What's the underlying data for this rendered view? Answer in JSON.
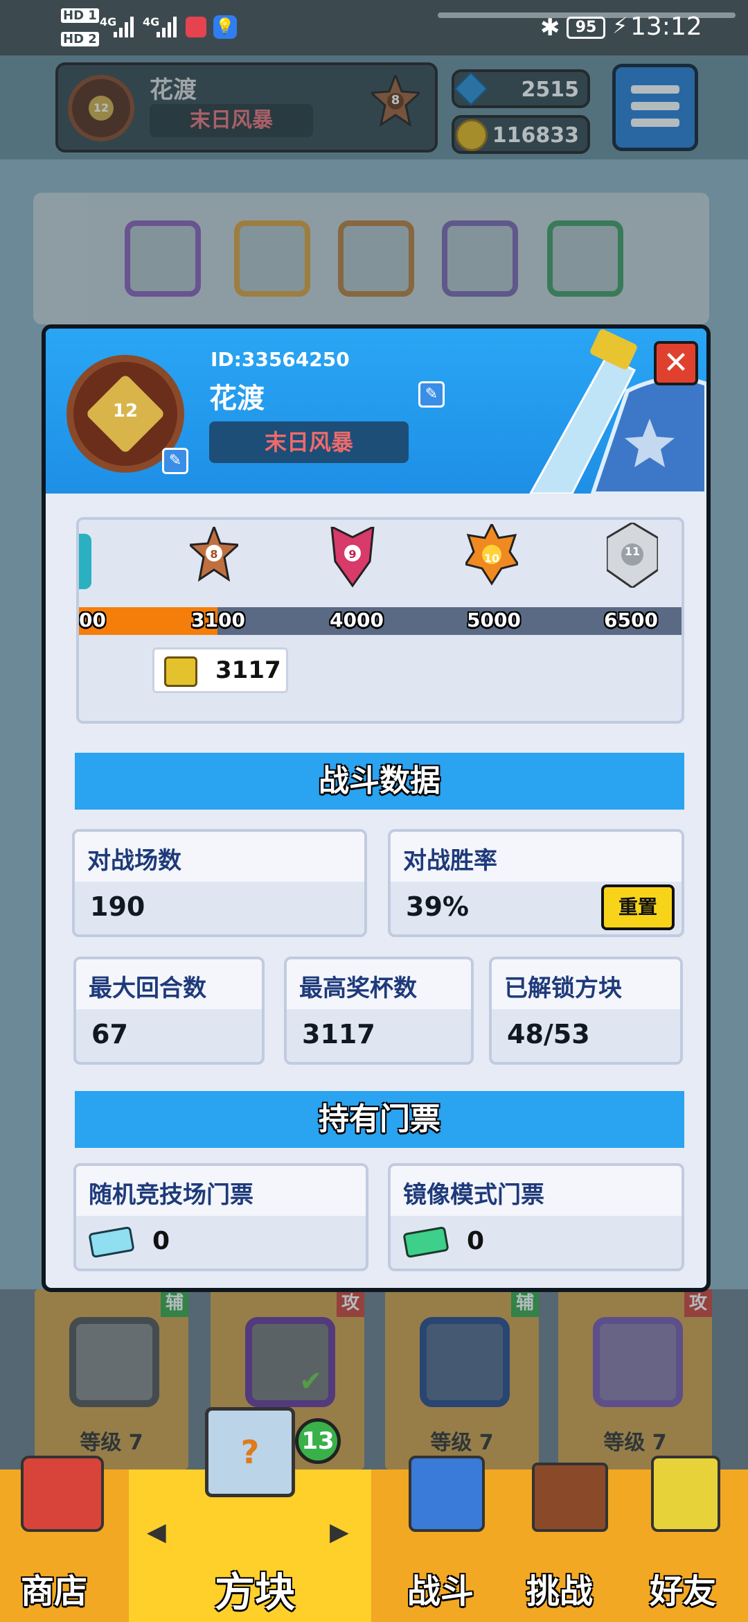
{
  "statusbar": {
    "sim1": "HD 1",
    "sim2": "HD 2",
    "net1": "4G",
    "net2": "4G",
    "battery": "95",
    "time": "13:12"
  },
  "hud": {
    "player_name": "花渡",
    "player_title": "末日风暴",
    "player_level": "12",
    "rank_badge": "8",
    "gems": "2515",
    "coins": "116833"
  },
  "modal": {
    "player_id": "ID:33564250",
    "player_name": "花渡",
    "player_title": "末日风暴",
    "player_level": "12",
    "rank_track": {
      "partial_left": "00",
      "ranks": [
        {
          "num": "8",
          "score": "3100"
        },
        {
          "num": "9",
          "score": "4000"
        },
        {
          "num": "10",
          "score": "5000"
        },
        {
          "num": "11",
          "score": "6500"
        }
      ],
      "current_trophies": "3117"
    },
    "battle_section_title": "战斗数据",
    "stats": {
      "battles_label": "对战场数",
      "battles_value": "190",
      "winrate_label": "对战胜率",
      "winrate_value": "39%",
      "reset_label": "重置",
      "max_rounds_label": "最大回合数",
      "max_rounds_value": "67",
      "max_trophies_label": "最高奖杯数",
      "max_trophies_value": "3117",
      "unlocked_label": "已解锁方块",
      "unlocked_value": "48/53"
    },
    "tickets_section_title": "持有门票",
    "tickets": {
      "random_label": "随机竞技场门票",
      "random_value": "0",
      "mirror_label": "镜像模式门票",
      "mirror_value": "0"
    }
  },
  "background": {
    "cards": [
      {
        "tag": "辅",
        "level": "等级 7"
      },
      {
        "tag": "攻",
        "level": ""
      },
      {
        "tag": "辅",
        "level": "等级 7"
      },
      {
        "tag": "攻",
        "level": "等级 7"
      }
    ],
    "cube_count": "13"
  },
  "nav": {
    "shop": "商店",
    "blocks": "方块",
    "battle": "战斗",
    "challenge": "挑战",
    "friends": "好友"
  }
}
